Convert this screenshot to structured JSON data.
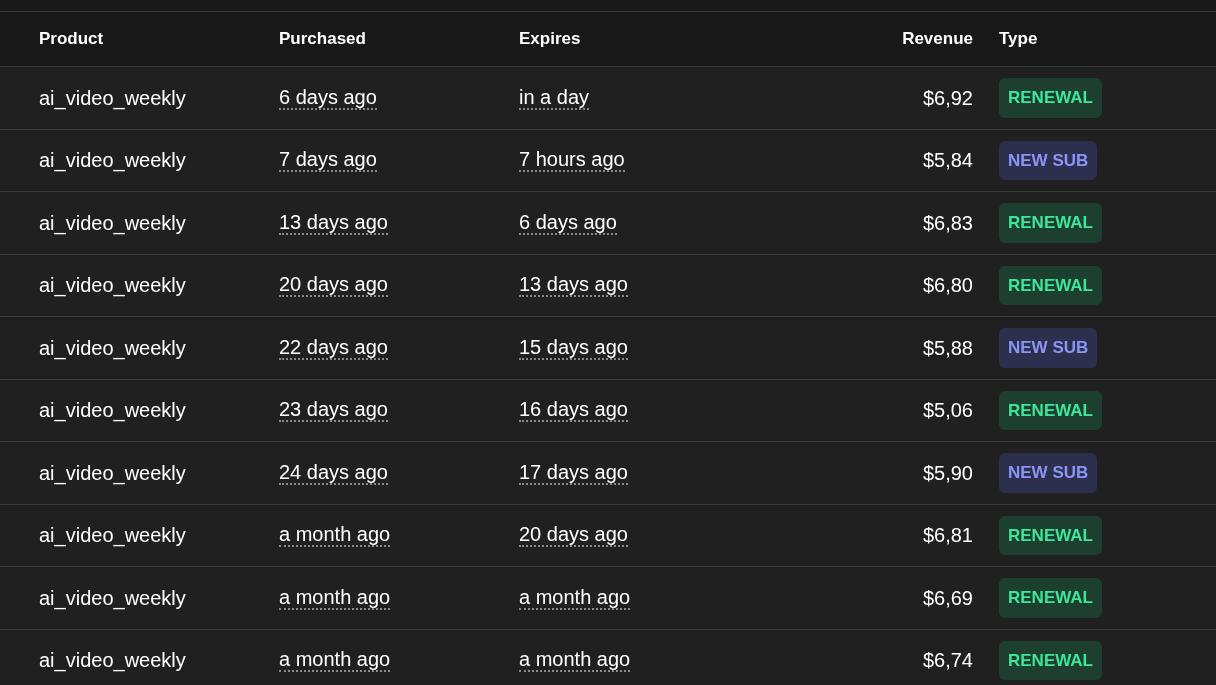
{
  "table": {
    "columns": [
      "Product",
      "Purchased",
      "Expires",
      "Revenue",
      "Type"
    ],
    "rows": [
      {
        "product": "ai_video_weekly",
        "purchased": "6 days ago",
        "expires": "in a day",
        "revenue": "$6,92",
        "type": {
          "label": "RENEWAL",
          "kind": "renewal"
        }
      },
      {
        "product": "ai_video_weekly",
        "purchased": "7 days ago",
        "expires": "7 hours ago",
        "revenue": "$5,84",
        "type": {
          "label": "NEW SUB",
          "kind": "new"
        }
      },
      {
        "product": "ai_video_weekly",
        "purchased": "13 days ago",
        "expires": "6 days ago",
        "revenue": "$6,83",
        "type": {
          "label": "RENEWAL",
          "kind": "renewal"
        }
      },
      {
        "product": "ai_video_weekly",
        "purchased": "20 days ago",
        "expires": "13 days ago",
        "revenue": "$6,80",
        "type": {
          "label": "RENEWAL",
          "kind": "renewal"
        }
      },
      {
        "product": "ai_video_weekly",
        "purchased": "22 days ago",
        "expires": "15 days ago",
        "revenue": "$5,88",
        "type": {
          "label": "NEW SUB",
          "kind": "new"
        }
      },
      {
        "product": "ai_video_weekly",
        "purchased": "23 days ago",
        "expires": "16 days ago",
        "revenue": "$5,06",
        "type": {
          "label": "RENEWAL",
          "kind": "renewal"
        }
      },
      {
        "product": "ai_video_weekly",
        "purchased": "24 days ago",
        "expires": "17 days ago",
        "revenue": "$5,90",
        "type": {
          "label": "NEW SUB",
          "kind": "new"
        }
      },
      {
        "product": "ai_video_weekly",
        "purchased": "a month ago",
        "expires": "20 days ago",
        "revenue": "$6,81",
        "type": {
          "label": "RENEWAL",
          "kind": "renewal"
        }
      },
      {
        "product": "ai_video_weekly",
        "purchased": "a month ago",
        "expires": "a month ago",
        "revenue": "$6,69",
        "type": {
          "label": "RENEWAL",
          "kind": "renewal"
        }
      },
      {
        "product": "ai_video_weekly",
        "purchased": "a month ago",
        "expires": "a month ago",
        "revenue": "$6,74",
        "type": {
          "label": "RENEWAL",
          "kind": "renewal"
        }
      }
    ]
  }
}
